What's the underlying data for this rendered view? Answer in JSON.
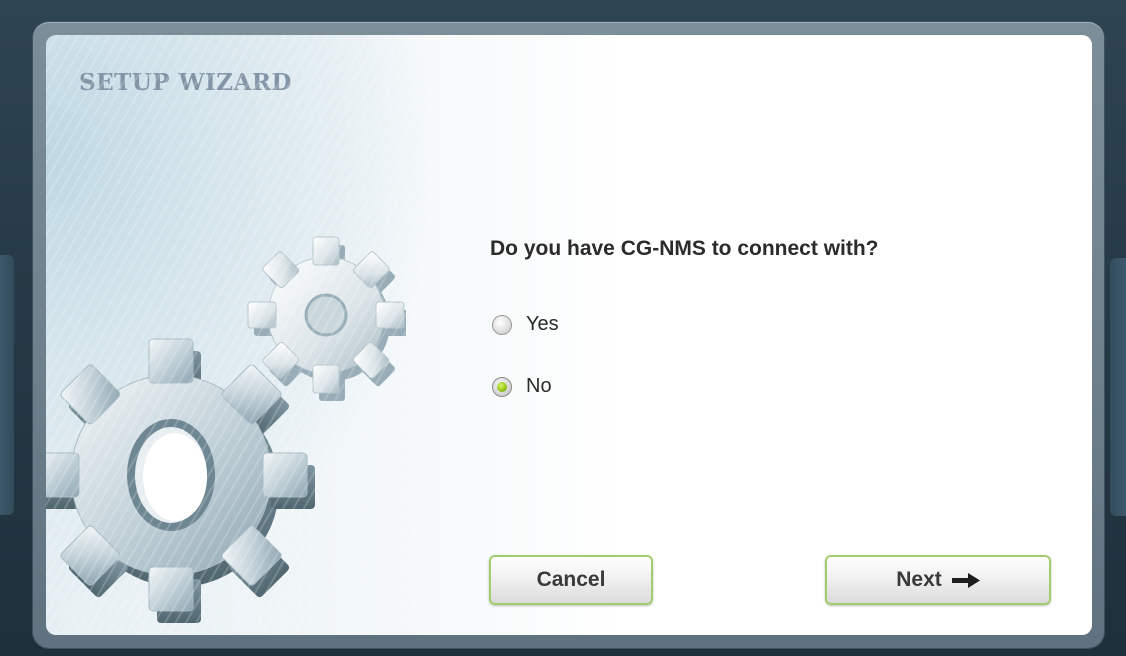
{
  "wizard": {
    "title": "SETUP WIZARD",
    "question": "Do you have CG-NMS to connect with?",
    "options": [
      {
        "label": "Yes",
        "selected": false
      },
      {
        "label": "No",
        "selected": true
      }
    ],
    "buttons": {
      "cancel_label": "Cancel",
      "next_label": "Next"
    }
  },
  "colors": {
    "accent_border": "#a3cc6c",
    "radio_selected": "#97c91a",
    "title_color": "#8394a6"
  },
  "icons": {
    "illustration": "gears-icon",
    "next_arrow": "arrow-right-icon"
  }
}
